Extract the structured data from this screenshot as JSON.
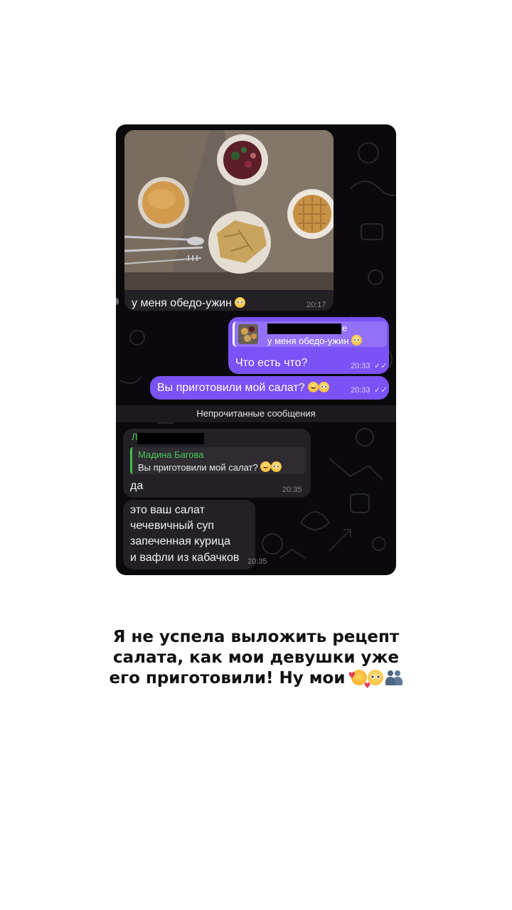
{
  "chat": {
    "photo_message": {
      "caption": "у меня обедо-ужин",
      "time": "20:17"
    },
    "reply_out": {
      "sender_suffix": "е",
      "quote": "у меня обедо-ужин",
      "text": "Что есть что?",
      "time": "20:33",
      "status": "✓✓"
    },
    "salad_out": {
      "text": "Вы приготовили мой салат?",
      "time": "20:33",
      "status": "✓✓"
    },
    "unread_bar": "Непрочитанные сообщения",
    "reply_in": {
      "sender_initial": "Л",
      "quote_name": "Мадина Багова",
      "quote_text": "Вы приготовили мой салат?",
      "text": "да",
      "time": "20:35"
    },
    "list_in": {
      "lines": [
        "это ваш салат",
        "чечевичный суп",
        "запеченная курица",
        "и вафли из кабачков"
      ],
      "time": "20:35"
    }
  },
  "story_caption": {
    "line1": "Я не успела выложить рецепт",
    "line2": "салата, как мои девушки уже",
    "line3": "его приготовили! Ну мои"
  },
  "colors": {
    "outgoing_bubble": "#7b52f5",
    "incoming_bubble": "#232026",
    "reply_accent_green": "#48c857"
  }
}
